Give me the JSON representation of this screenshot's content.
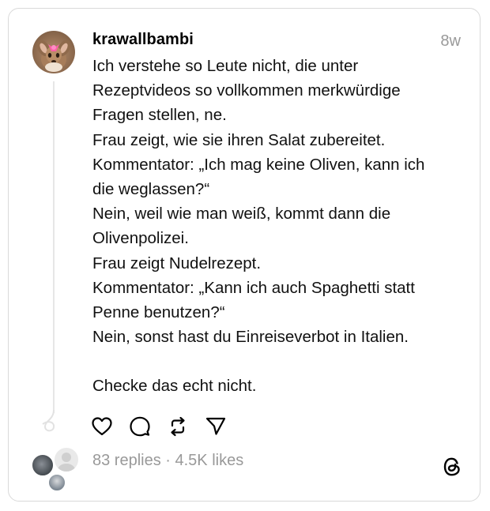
{
  "post": {
    "username": "krawallbambi",
    "time": "8w",
    "lines": [
      "Ich verstehe so Leute nicht, die unter",
      "Rezeptvideos so vollkommen merkwürdige",
      "Fragen stellen, ne.",
      "Frau zeigt, wie sie ihren Salat zubereitet.",
      "Kommentator: „Ich mag keine Oliven, kann ich",
      "die weglassen?“",
      "Nein, weil wie man weiß, kommt dann die",
      "Olivenpolizei.",
      "Frau zeigt Nudelrezept.",
      "Kommentator: „Kann ich auch Spaghetti statt",
      "Penne benutzen?“",
      "Nein, sonst hast du Einreiseverbot in Italien.",
      "",
      "Checke das echt nicht."
    ]
  },
  "actions": {
    "like_icon": "heart-icon",
    "reply_icon": "comment-bubble-icon",
    "repost_icon": "repost-icon",
    "share_icon": "send-icon"
  },
  "stats": {
    "replies": "83 replies",
    "separator": " · ",
    "likes": "4.5K likes"
  },
  "brand": {
    "logo_icon": "threads-logo-icon"
  },
  "colors": {
    "text": "#000000",
    "muted": "#999999",
    "border": "#d9d9d9"
  }
}
